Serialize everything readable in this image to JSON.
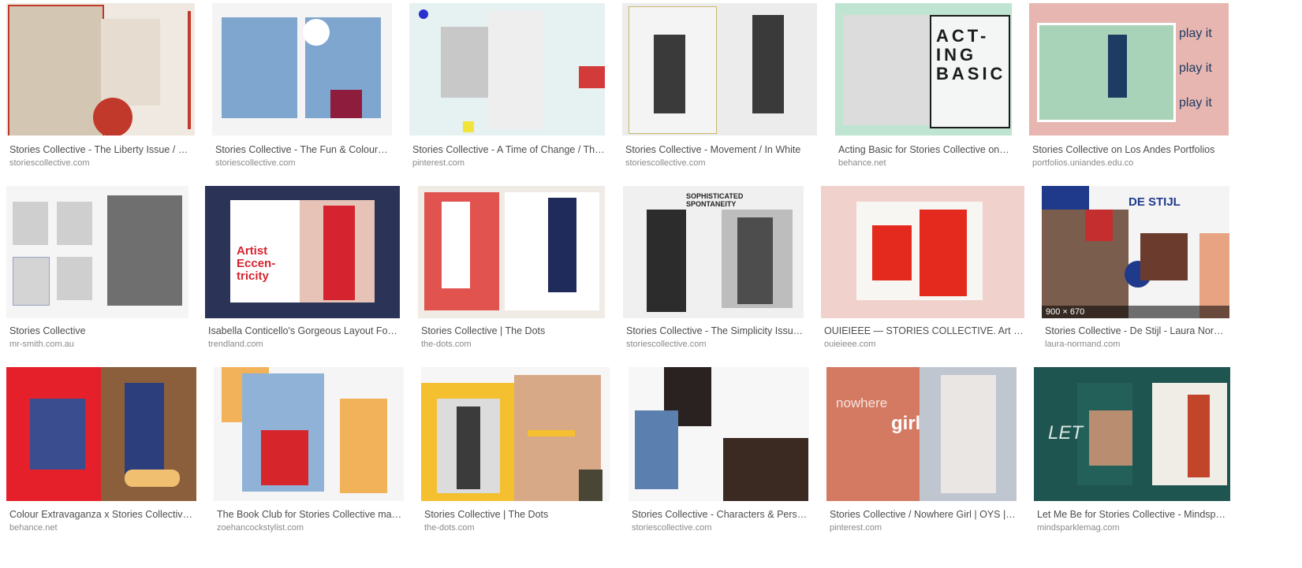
{
  "results": [
    {
      "caption": "Stories Collective - The Liberty Issue / Ha…",
      "source": "storiescollective.com",
      "icon": "image-thumbnail",
      "colors": [
        "#efe9e1",
        "#d3c7b4",
        "#c0392b"
      ]
    },
    {
      "caption": "Stories Collective - The Fun & Colours I…",
      "source": "storiescollective.com",
      "icon": "image-thumbnail",
      "colors": [
        "#f4f4f4",
        "#7ea6cf",
        "#8d1c3d"
      ]
    },
    {
      "caption": "Stories Collective - A Time of Change / Thr…",
      "source": "pinterest.com",
      "icon": "image-thumbnail",
      "colors": [
        "#e6f1f1",
        "#d33a3a",
        "#c8c8c8"
      ]
    },
    {
      "caption": "Stories Collective - Movement / In White",
      "source": "storiescollective.com",
      "icon": "image-thumbnail",
      "colors": [
        "#ececec",
        "#3a3a3a",
        "#bcbcbc"
      ]
    },
    {
      "caption": "Acting Basic for Stories Collective on B…",
      "source": "behance.net",
      "icon": "image-thumbnail",
      "colors": [
        "#bfe4d1",
        "#1b1b1b",
        "#dcdcdc"
      ]
    },
    {
      "caption": "Stories Collective on Los Andes Portfolios",
      "source": "portfolios.uniandes.edu.co",
      "icon": "image-thumbnail",
      "colors": [
        "#e7b6b0",
        "#a9d3b8",
        "#1d3b63"
      ]
    },
    {
      "caption": "Stories Collective",
      "source": "mr-smith.com.au",
      "icon": "image-thumbnail",
      "colors": [
        "#f5f5f5",
        "#6f6f6f",
        "#9aa0c8"
      ]
    },
    {
      "caption": "Isabella Conticello's Gorgeous Layout For …",
      "source": "trendland.com",
      "icon": "image-thumbnail",
      "colors": [
        "#2b3457",
        "#e7c3b7",
        "#d5232f"
      ]
    },
    {
      "caption": "Stories Collective | The Dots",
      "source": "the-dots.com",
      "icon": "image-thumbnail",
      "colors": [
        "#f1ebe6",
        "#e0534f",
        "#1f2b5a"
      ]
    },
    {
      "caption": "Stories Collective - The Simplicity Issue…",
      "source": "storiescollective.com",
      "icon": "image-thumbnail",
      "colors": [
        "#f0f0f0",
        "#4d4d4d",
        "#bdbdbd"
      ]
    },
    {
      "caption": "OUIEIEEE — STORIES COLLECTIVE. Art S…",
      "source": "ouieieee.com",
      "icon": "image-thumbnail",
      "colors": [
        "#f1d1cb",
        "#e42a1e",
        "#f8f6f2"
      ]
    },
    {
      "caption": "Stories Collective - De Stijl - Laura Norm…",
      "source": "laura-normand.com",
      "icon": "image-thumbnail",
      "colors": [
        "#f4f4f4",
        "#1f3a8a",
        "#c42e2e"
      ]
    },
    {
      "caption": "Colour Extravaganza x Stories Collective …",
      "source": "behance.net",
      "icon": "image-thumbnail",
      "colors": [
        "#e5202a",
        "#8b5e3c",
        "#f3e8d6"
      ]
    },
    {
      "caption": "The Book Club for Stories Collective mag…",
      "source": "zoehancockstylist.com",
      "icon": "image-thumbnail",
      "colors": [
        "#f5f5f5",
        "#f1b25a",
        "#8fb2d6"
      ]
    },
    {
      "caption": "Stories Collective | The Dots",
      "source": "the-dots.com",
      "icon": "image-thumbnail",
      "colors": [
        "#f6f6f6",
        "#f4c030",
        "#3b3b3b"
      ]
    },
    {
      "caption": "Stories Collective - Characters & Perso…",
      "source": "storiescollective.com",
      "icon": "image-thumbnail",
      "colors": [
        "#f7f7f7",
        "#2a2220",
        "#5b7fae"
      ]
    },
    {
      "caption": "Stories Collective / Nowhere Girl | OYS | …",
      "source": "pinterest.com",
      "icon": "image-thumbnail",
      "colors": [
        "#d47a63",
        "#e9e6e3",
        "#bfc6cf"
      ]
    },
    {
      "caption": "Let Me Be for Stories Collective - Mindspar…",
      "source": "mindsparklemag.com",
      "icon": "image-thumbnail",
      "colors": [
        "#1f5550",
        "#f0ece6",
        "#c2452b"
      ]
    }
  ],
  "texts": {
    "t5": "ACT-\nING\nBASIC",
    "t6": "play it",
    "t8": "Artist\nEccen-\ntricity",
    "t10": "SOPHISTICATED\nSPONTANEITY",
    "t12": "DE STIJL",
    "t12badge": "900 × 670",
    "t17a": "nowhere",
    "t17b": "girl",
    "t18": "LET"
  }
}
